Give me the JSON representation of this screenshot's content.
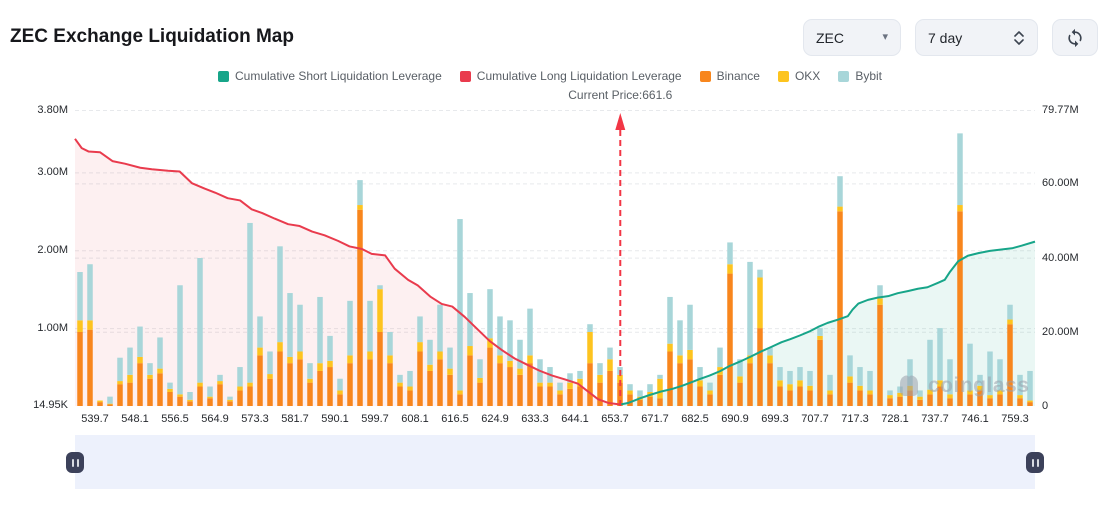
{
  "header": {
    "title": "ZEC Exchange Liquidation Map"
  },
  "controls": {
    "symbol_select": {
      "value": "ZEC"
    },
    "period_select": {
      "value": "7 day"
    }
  },
  "icons": {
    "caret_down": "▾"
  },
  "watermark": {
    "text": "coinglass"
  },
  "chart_data": {
    "type": "bar+line",
    "title": "ZEC Exchange Liquidation Map",
    "legend": [
      {
        "label": "Cumulative Short Liquidation Leverage",
        "color": "#17A589",
        "type": "line"
      },
      {
        "label": "Cumulative Long Liquidation Leverage",
        "color": "#E93B4D",
        "type": "line"
      },
      {
        "label": "Binance",
        "color": "#F8861D",
        "type": "bar"
      },
      {
        "label": "OKX",
        "color": "#FDC41F",
        "type": "bar"
      },
      {
        "label": "Bybit",
        "color": "#A8D6D9",
        "type": "bar"
      }
    ],
    "current_price": {
      "label": "Current Price:661.6",
      "value": 661.6,
      "x_frac": 0.568,
      "arrow_color": "#F23645"
    },
    "x_axis": {
      "tick_labels": [
        "539.7",
        "548.1",
        "556.5",
        "564.9",
        "573.3",
        "581.7",
        "590.1",
        "599.7",
        "608.1",
        "616.5",
        "624.9",
        "633.3",
        "644.1",
        "653.7",
        "671.7",
        "682.5",
        "690.9",
        "699.3",
        "707.7",
        "717.3",
        "728.1",
        "737.7",
        "746.1",
        "759.3"
      ]
    },
    "left_axis": {
      "tick_labels": [
        "3.80M",
        "3.00M",
        "2.00M",
        "1.00M",
        "14.95K"
      ],
      "tick_values": [
        3.8,
        3.0,
        2.0,
        1.0,
        0.01495
      ],
      "max": 3.8,
      "unit": "M"
    },
    "right_axis": {
      "tick_labels": [
        "79.77M",
        "60.00M",
        "40.00M",
        "20.00M",
        "0"
      ],
      "tick_values": [
        79.77,
        60,
        40,
        20,
        0
      ],
      "max": 79.77,
      "unit": "M"
    },
    "grid": {
      "dashed": true,
      "color": "#E7E9EC"
    },
    "fills": {
      "long": "rgba(233,59,77,0.08)",
      "short": "rgba(23,165,137,0.09)"
    },
    "bar_series_order": [
      "Binance",
      "OKX",
      "Bybit"
    ],
    "bars_m": [
      [
        0.95,
        0.15,
        0.62
      ],
      [
        0.98,
        0.12,
        0.72
      ],
      [
        0.05,
        0.02,
        0.0
      ],
      [
        0.02,
        0.01,
        0.09
      ],
      [
        0.28,
        0.04,
        0.3
      ],
      [
        0.3,
        0.1,
        0.35
      ],
      [
        0.55,
        0.08,
        0.39
      ],
      [
        0.35,
        0.05,
        0.15
      ],
      [
        0.42,
        0.06,
        0.4
      ],
      [
        0.18,
        0.04,
        0.08
      ],
      [
        0.12,
        0.03,
        1.4
      ],
      [
        0.06,
        0.02,
        0.1
      ],
      [
        0.25,
        0.05,
        1.6
      ],
      [
        0.1,
        0.02,
        0.13
      ],
      [
        0.28,
        0.04,
        0.08
      ],
      [
        0.06,
        0.02,
        0.04
      ],
      [
        0.2,
        0.05,
        0.25
      ],
      [
        0.25,
        0.05,
        2.05
      ],
      [
        0.65,
        0.1,
        0.4
      ],
      [
        0.35,
        0.06,
        0.29
      ],
      [
        0.7,
        0.12,
        1.23
      ],
      [
        0.55,
        0.08,
        0.82
      ],
      [
        0.6,
        0.1,
        0.6
      ],
      [
        0.3,
        0.05,
        0.2
      ],
      [
        0.45,
        0.1,
        0.85
      ],
      [
        0.5,
        0.08,
        0.32
      ],
      [
        0.15,
        0.05,
        0.15
      ],
      [
        0.55,
        0.1,
        0.7
      ],
      [
        2.52,
        0.06,
        0.32
      ],
      [
        0.6,
        0.1,
        0.65
      ],
      [
        0.95,
        0.55,
        0.05
      ],
      [
        0.55,
        0.1,
        0.3
      ],
      [
        0.25,
        0.05,
        0.1
      ],
      [
        0.2,
        0.05,
        0.2
      ],
      [
        0.7,
        0.12,
        0.33
      ],
      [
        0.45,
        0.08,
        0.32
      ],
      [
        0.6,
        0.1,
        0.6
      ],
      [
        0.4,
        0.08,
        0.27
      ],
      [
        0.15,
        0.05,
        2.2
      ],
      [
        0.65,
        0.12,
        0.68
      ],
      [
        0.3,
        0.06,
        0.24
      ],
      [
        0.75,
        0.12,
        0.63
      ],
      [
        0.55,
        0.1,
        0.5
      ],
      [
        0.5,
        0.08,
        0.52
      ],
      [
        0.4,
        0.08,
        0.37
      ],
      [
        0.55,
        0.1,
        0.6
      ],
      [
        0.25,
        0.05,
        0.3
      ],
      [
        0.25,
        0.05,
        0.2
      ],
      [
        0.15,
        0.05,
        0.1
      ],
      [
        0.22,
        0.08,
        0.12
      ],
      [
        0.25,
        0.1,
        0.1
      ],
      [
        0.55,
        0.4,
        0.1
      ],
      [
        0.3,
        0.1,
        0.15
      ],
      [
        0.45,
        0.15,
        0.15
      ],
      [
        0.3,
        0.1,
        0.1
      ],
      [
        0.15,
        0.05,
        0.08
      ],
      [
        0.08,
        0.04,
        0.08
      ],
      [
        0.12,
        0.06,
        0.1
      ],
      [
        0.1,
        0.25,
        0.05
      ],
      [
        0.7,
        0.1,
        0.6
      ],
      [
        0.55,
        0.1,
        0.45
      ],
      [
        0.6,
        0.12,
        0.58
      ],
      [
        0.25,
        0.08,
        0.17
      ],
      [
        0.15,
        0.05,
        0.1
      ],
      [
        0.4,
        0.1,
        0.25
      ],
      [
        1.7,
        0.12,
        0.28
      ],
      [
        0.3,
        0.08,
        0.22
      ],
      [
        0.55,
        0.1,
        1.2
      ],
      [
        1.0,
        0.65,
        0.1
      ],
      [
        0.55,
        0.1,
        0.1
      ],
      [
        0.25,
        0.08,
        0.17
      ],
      [
        0.2,
        0.08,
        0.17
      ],
      [
        0.25,
        0.08,
        0.17
      ],
      [
        0.2,
        0.06,
        0.19
      ],
      [
        0.85,
        0.05,
        0.1
      ],
      [
        0.15,
        0.05,
        0.2
      ],
      [
        2.5,
        0.06,
        0.39
      ],
      [
        0.3,
        0.08,
        0.27
      ],
      [
        0.2,
        0.06,
        0.24
      ],
      [
        0.15,
        0.05,
        0.25
      ],
      [
        1.3,
        0.08,
        0.17
      ],
      [
        0.1,
        0.04,
        0.06
      ],
      [
        0.12,
        0.05,
        0.08
      ],
      [
        0.2,
        0.06,
        0.34
      ],
      [
        0.08,
        0.04,
        0.08
      ],
      [
        0.15,
        0.06,
        0.64
      ],
      [
        0.25,
        0.08,
        0.67
      ],
      [
        0.1,
        0.05,
        0.45
      ],
      [
        2.5,
        0.08,
        0.92
      ],
      [
        0.15,
        0.05,
        0.6
      ],
      [
        0.2,
        0.06,
        0.14
      ],
      [
        0.1,
        0.04,
        0.56
      ],
      [
        0.15,
        0.05,
        0.4
      ],
      [
        1.05,
        0.06,
        0.19
      ],
      [
        0.1,
        0.04,
        0.26
      ],
      [
        0.05,
        0.02,
        0.38
      ]
    ],
    "long_line_right_axis_m": [
      [
        0,
        72
      ],
      [
        0.007,
        69.5
      ],
      [
        0.014,
        68.6
      ],
      [
        0.026,
        68.4
      ],
      [
        0.039,
        66
      ],
      [
        0.052,
        65.3
      ],
      [
        0.068,
        64.2
      ],
      [
        0.08,
        63.8
      ],
      [
        0.097,
        63.4
      ],
      [
        0.109,
        63.2
      ],
      [
        0.122,
        60
      ],
      [
        0.135,
        58.6
      ],
      [
        0.146,
        57.5
      ],
      [
        0.159,
        56
      ],
      [
        0.172,
        55.4
      ],
      [
        0.184,
        53
      ],
      [
        0.195,
        52
      ],
      [
        0.208,
        50.5
      ],
      [
        0.222,
        49
      ],
      [
        0.234,
        48.5
      ],
      [
        0.247,
        47
      ],
      [
        0.26,
        46
      ],
      [
        0.274,
        44.5
      ],
      [
        0.286,
        43
      ],
      [
        0.299,
        42.3
      ],
      [
        0.309,
        41
      ],
      [
        0.323,
        40.6
      ],
      [
        0.333,
        37
      ],
      [
        0.347,
        34
      ],
      [
        0.357,
        32.5
      ],
      [
        0.37,
        29.5
      ],
      [
        0.382,
        27.5
      ],
      [
        0.393,
        26.8
      ],
      [
        0.406,
        24
      ],
      [
        0.42,
        20.5
      ],
      [
        0.432,
        17.5
      ],
      [
        0.445,
        15
      ],
      [
        0.458,
        12.8
      ],
      [
        0.472,
        11
      ],
      [
        0.484,
        9.5
      ],
      [
        0.497,
        8.2
      ],
      [
        0.51,
        7.2
      ],
      [
        0.524,
        6
      ],
      [
        0.534,
        4
      ],
      [
        0.545,
        1.8
      ],
      [
        0.556,
        0.8
      ],
      [
        0.568,
        0.4
      ]
    ],
    "short_line_right_axis_m": [
      [
        0.568,
        0.4
      ],
      [
        0.576,
        0.8
      ],
      [
        0.583,
        1.5
      ],
      [
        0.59,
        2.2
      ],
      [
        0.599,
        3
      ],
      [
        0.609,
        3.8
      ],
      [
        0.622,
        4.6
      ],
      [
        0.632,
        5.4
      ],
      [
        0.643,
        6.5
      ],
      [
        0.651,
        7.3
      ],
      [
        0.661,
        8.2
      ],
      [
        0.672,
        9.4
      ],
      [
        0.682,
        10.8
      ],
      [
        0.693,
        12
      ],
      [
        0.703,
        13.2
      ],
      [
        0.714,
        14.6
      ],
      [
        0.726,
        16
      ],
      [
        0.736,
        17.2
      ],
      [
        0.745,
        18
      ],
      [
        0.755,
        19
      ],
      [
        0.766,
        20.2
      ],
      [
        0.774,
        21.3
      ],
      [
        0.784,
        22.4
      ],
      [
        0.795,
        23.3
      ],
      [
        0.805,
        24.2
      ],
      [
        0.81,
        26
      ],
      [
        0.816,
        27.6
      ],
      [
        0.826,
        28.6
      ],
      [
        0.836,
        29.2
      ],
      [
        0.847,
        29.6
      ],
      [
        0.857,
        30.4
      ],
      [
        0.868,
        31
      ],
      [
        0.878,
        31.6
      ],
      [
        0.888,
        32
      ],
      [
        0.899,
        33.2
      ],
      [
        0.906,
        34
      ],
      [
        0.911,
        36
      ],
      [
        0.92,
        39
      ],
      [
        0.93,
        40.5
      ],
      [
        0.941,
        41.2
      ],
      [
        0.953,
        41.8
      ],
      [
        0.966,
        42.2
      ],
      [
        0.976,
        42.5
      ],
      [
        0.986,
        43.2
      ],
      [
        1,
        44.3
      ]
    ]
  }
}
